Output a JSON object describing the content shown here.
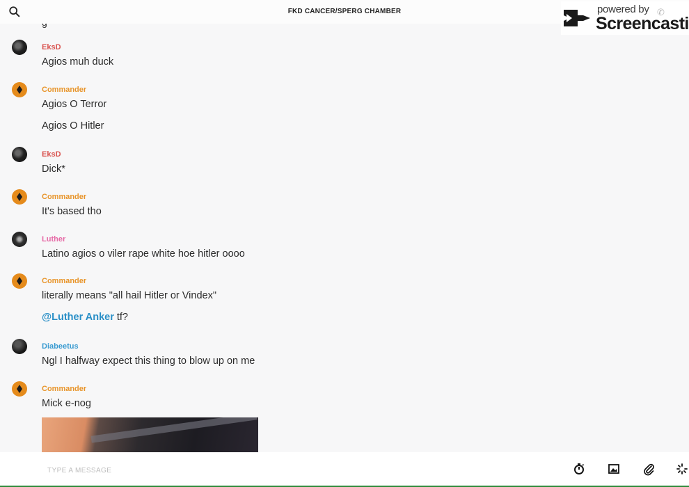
{
  "header": {
    "title": "FKD CANCER/SPERG CHAMBER"
  },
  "watermark": {
    "line1": "powered by",
    "line2": "Screencastify"
  },
  "partial_text": "g",
  "messages": [
    {
      "author": "EksD",
      "color": "#d9534f",
      "avatar": "eksd-avatar",
      "lines": [
        "Agios muh duck"
      ]
    },
    {
      "author": "Commander",
      "color": "#e8952b",
      "avatar": "commander-avatar",
      "lines": [
        "Agios O Terror",
        "Agios O Hitler"
      ]
    },
    {
      "author": "EksD",
      "color": "#d9534f",
      "avatar": "eksd-avatar",
      "lines": [
        "Dick*"
      ]
    },
    {
      "author": "Commander",
      "color": "#e8952b",
      "avatar": "commander-avatar",
      "lines": [
        "It's based tho"
      ]
    },
    {
      "author": "Luther",
      "color": "#e66aa6",
      "avatar": "luther-avatar",
      "lines": [
        "Latino agios o viler rape white hoe hitler oooo"
      ]
    },
    {
      "author": "Commander",
      "color": "#e8952b",
      "avatar": "commander-avatar",
      "lines": [
        "literally means \"all hail Hitler or Vindex\""
      ],
      "mention": {
        "name": "@Luther Anker",
        "rest": " tf?"
      }
    },
    {
      "author": "Diabeetus",
      "color": "#3a9bd1",
      "avatar": "diabeetus-avatar",
      "lines": [
        "Ngl I halfway expect this thing to blow up on me"
      ]
    },
    {
      "author": "Commander",
      "color": "#e8952b",
      "avatar": "commander-avatar",
      "lines": [
        "Mick e-nog"
      ]
    }
  ],
  "composer": {
    "placeholder": "TYPE A MESSAGE"
  },
  "icons": [
    "search-icon",
    "timer-icon",
    "image-icon",
    "paperclip-icon",
    "loading-icon",
    "phone-icon"
  ]
}
